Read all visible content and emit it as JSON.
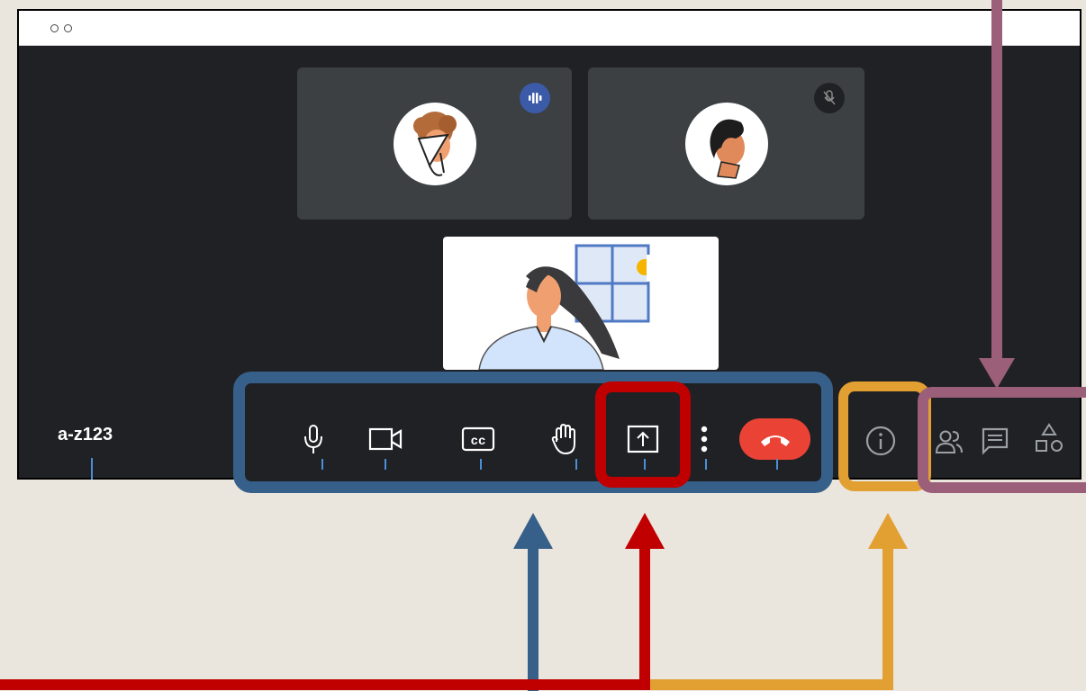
{
  "meeting": {
    "code": "a-z123"
  },
  "participants": [
    {
      "name_icon": "participant-avatar-curly-hair",
      "speaking": true
    },
    {
      "name_icon": "participant-avatar-dark-hair",
      "muted": true
    }
  ],
  "toolbar": {
    "buttons": [
      {
        "icon": "microphone-icon"
      },
      {
        "icon": "camera-icon"
      },
      {
        "icon": "captions-icon",
        "label": "cc"
      },
      {
        "icon": "raise-hand-icon"
      },
      {
        "icon": "present-screen-icon"
      },
      {
        "icon": "more-options-icon"
      },
      {
        "icon": "end-call-icon"
      }
    ]
  },
  "side_controls": [
    {
      "icon": "info-icon"
    },
    {
      "icon": "people-icon"
    },
    {
      "icon": "chat-icon"
    },
    {
      "icon": "activities-icon"
    }
  ],
  "colors": {
    "annotation_blue": "#36608a",
    "annotation_red": "#c00000",
    "annotation_orange": "#e3a032",
    "annotation_mauve": "#9b5f7a",
    "end_call": "#ea4335",
    "speaking_badge": "#3b5ba8",
    "window_bg": "#202124",
    "tile_bg": "#3c4043"
  }
}
